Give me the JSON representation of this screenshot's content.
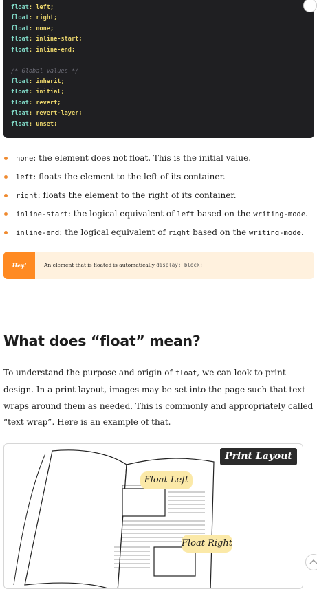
{
  "code": {
    "lines": [
      {
        "prop": "float",
        "value": "left"
      },
      {
        "prop": "float",
        "value": "right"
      },
      {
        "prop": "float",
        "value": "none"
      },
      {
        "prop": "float",
        "value": "inline-start"
      },
      {
        "prop": "float",
        "value": "inline-end"
      }
    ],
    "comment": "/* Global values */",
    "global_lines": [
      {
        "prop": "float",
        "value": "inherit"
      },
      {
        "prop": "float",
        "value": "initial"
      },
      {
        "prop": "float",
        "value": "revert"
      },
      {
        "prop": "float",
        "value": "revert-layer"
      },
      {
        "prop": "float",
        "value": "unset"
      }
    ]
  },
  "bullets": [
    {
      "code": "none",
      "text": ": the element does not float. This is the initial value."
    },
    {
      "code": "left",
      "text": ": floats the element to the left of its container."
    },
    {
      "code": "right",
      "text": ": floats the element to the right of its container."
    },
    {
      "code": "inline-start",
      "text": ": the logical equivalent of ",
      "code2": "left",
      "text2": " based on the ",
      "code3": "writing-mode",
      "text3": "."
    },
    {
      "code": "inline-end",
      "text": ": the logical equivalent of ",
      "code2": "right",
      "text2": " based on the ",
      "code3": "writing-mode",
      "text3": "."
    }
  ],
  "callout": {
    "badge": "Hey!",
    "text": "An element that is floated is automatically ",
    "code": "display: block;"
  },
  "section": {
    "heading": "What does “float” mean?",
    "para_1": "To understand the purpose and origin of ",
    "para_code": "float",
    "para_2": ", we can look to print design. In a print layout, images may be set into the page such that text wraps around them as needed. This is commonly and appropriately called “text wrap”. Here is an example of that."
  },
  "figure": {
    "title": "Print Layout",
    "label_left": "Float Left",
    "label_right": "Float Right"
  },
  "colors": {
    "accent": "#ff8a22",
    "code_bg": "#1f1f22",
    "callout_bg": "#fff1de"
  }
}
